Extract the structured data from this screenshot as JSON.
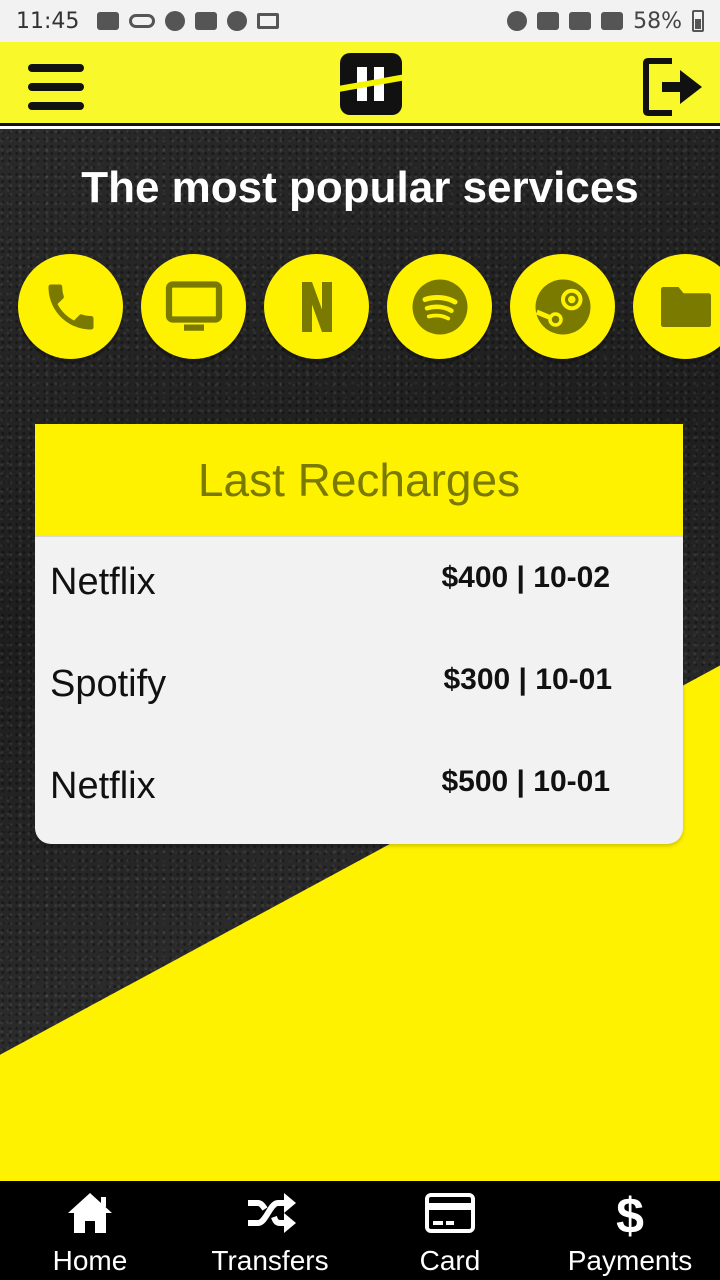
{
  "status_bar": {
    "time": "11:45",
    "battery": "58%"
  },
  "app_bar": {
    "menu_icon": "hamburger-icon",
    "logo_icon": "app-logo",
    "logout_icon": "logout-icon"
  },
  "headline": "The most popular services",
  "services": [
    {
      "name": "phone",
      "icon": "phone-icon"
    },
    {
      "name": "tv",
      "icon": "tv-icon"
    },
    {
      "name": "netflix",
      "icon": "netflix-icon"
    },
    {
      "name": "spotify",
      "icon": "spotify-icon"
    },
    {
      "name": "steam",
      "icon": "steam-icon"
    },
    {
      "name": "folder",
      "icon": "folder-icon"
    }
  ],
  "recharges": {
    "title": "Last Recharges",
    "rows": [
      {
        "name": "Netflix",
        "amount": "$400 | 10-02"
      },
      {
        "name": "Spotify",
        "amount": "$300 | 10-01"
      },
      {
        "name": "Netflix",
        "amount": "$500 | 10-01"
      }
    ]
  },
  "bottom_nav": [
    {
      "label": "Home",
      "icon": "home-icon"
    },
    {
      "label": "Transfers",
      "icon": "shuffle-icon"
    },
    {
      "label": "Card",
      "icon": "credit-card-icon"
    },
    {
      "label": "Payments",
      "icon": "dollar-icon"
    }
  ],
  "colors": {
    "accent": "#fff200",
    "app_bar": "#f8f82a",
    "icon_olive": "#7a7a00",
    "nav_bg": "#000000"
  }
}
